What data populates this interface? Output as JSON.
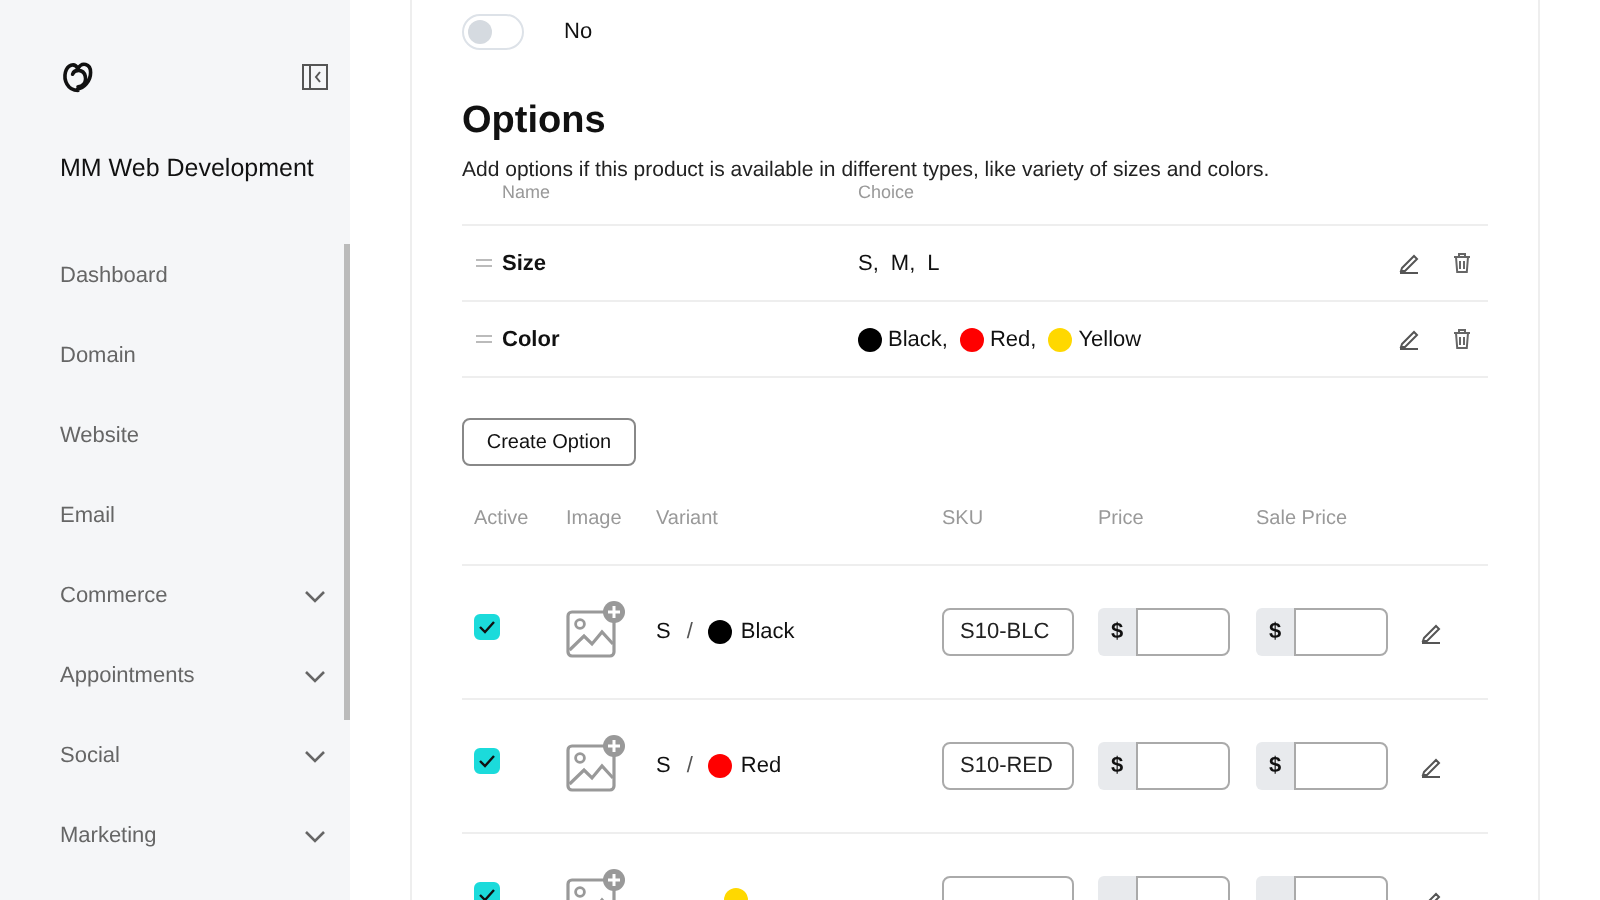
{
  "sidebar": {
    "brand": "MM Web Development",
    "items": [
      {
        "label": "Dashboard",
        "expandable": false
      },
      {
        "label": "Domain",
        "expandable": false
      },
      {
        "label": "Website",
        "expandable": false
      },
      {
        "label": "Email",
        "expandable": false
      },
      {
        "label": "Commerce",
        "expandable": true
      },
      {
        "label": "Appointments",
        "expandable": true
      },
      {
        "label": "Social",
        "expandable": true
      },
      {
        "label": "Marketing",
        "expandable": true
      }
    ]
  },
  "toggle": {
    "on": false,
    "label": "No"
  },
  "options": {
    "title": "Options",
    "description": "Add options if this product is available in different types, like variety of sizes and colors.",
    "columns": [
      "Name",
      "Choice"
    ],
    "rows": [
      {
        "name": "Size",
        "choices": [
          {
            "label": "S,"
          },
          {
            "label": "M,"
          },
          {
            "label": "L"
          }
        ]
      },
      {
        "name": "Color",
        "choices": [
          {
            "label": "Black,",
            "color": "#000000"
          },
          {
            "label": "Red,",
            "color": "#ff0000"
          },
          {
            "label": "Yellow",
            "color": "#ffd800"
          }
        ]
      }
    ]
  },
  "create_button": "Create Option",
  "variants": {
    "columns": [
      "Active",
      "Image",
      "Variant",
      "SKU",
      "Price",
      "Sale Price"
    ],
    "rows": [
      {
        "active": true,
        "size": "S",
        "separator": "/",
        "color_name": "Black",
        "color": "#000000",
        "sku": "S10-BLC",
        "currency": "$",
        "sale_currency": "$"
      },
      {
        "active": true,
        "size": "S",
        "separator": "/",
        "color_name": "Red",
        "color": "#ff0000",
        "sku": "S10-RED",
        "currency": "$",
        "sale_currency": "$"
      },
      {
        "active": true,
        "color": "#ffd800"
      }
    ]
  }
}
